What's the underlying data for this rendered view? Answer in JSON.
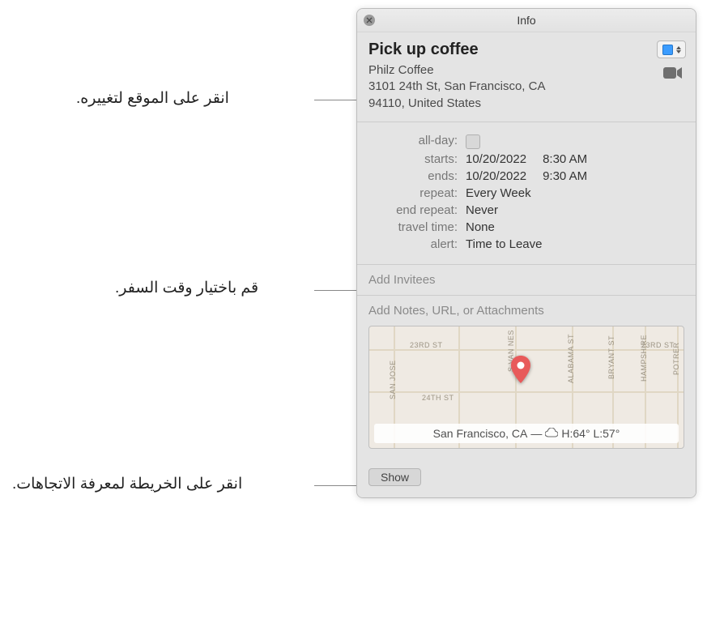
{
  "window": {
    "title": "Info"
  },
  "event": {
    "title": "Pick up coffee",
    "location_name": "Philz Coffee",
    "location_addr1": "3101 24th St, San Francisco, CA",
    "location_addr2": "94110, United States"
  },
  "fields": {
    "allday_label": "all-day:",
    "starts_label": "starts:",
    "ends_label": "ends:",
    "repeat_label": "repeat:",
    "endrepeat_label": "end repeat:",
    "travel_label": "travel time:",
    "alert_label": "alert:",
    "starts_date": "10/20/2022",
    "starts_time": "8:30 AM",
    "ends_date": "10/20/2022",
    "ends_time": "9:30 AM",
    "repeat_value": "Every Week",
    "endrepeat_value": "Never",
    "travel_value": "None",
    "alert_value": "Time to Leave"
  },
  "invitees": {
    "placeholder": "Add Invitees"
  },
  "notes": {
    "placeholder": "Add Notes, URL, or Attachments"
  },
  "map": {
    "st_23rd": "23RD ST",
    "st_24th": "24TH ST",
    "st_svn": "S VAN NES",
    "st_alabama": "ALABAMA ST",
    "st_bryant": "BRYANT ST",
    "st_hampshire": "HAMPSHIRE",
    "st_potrer": "POTRER",
    "st_sanjose": "SAN JOSE",
    "weather_city": "San Francisco, CA",
    "weather_sep": " — ",
    "weather_temp": "H:64° L:57°"
  },
  "footer": {
    "show_label": "Show"
  },
  "callouts": {
    "location": "انقر على الموقع لتغييره.",
    "travel": "قم باختيار وقت السفر.",
    "map": "انقر على الخريطة لمعرفة الاتجاهات."
  }
}
